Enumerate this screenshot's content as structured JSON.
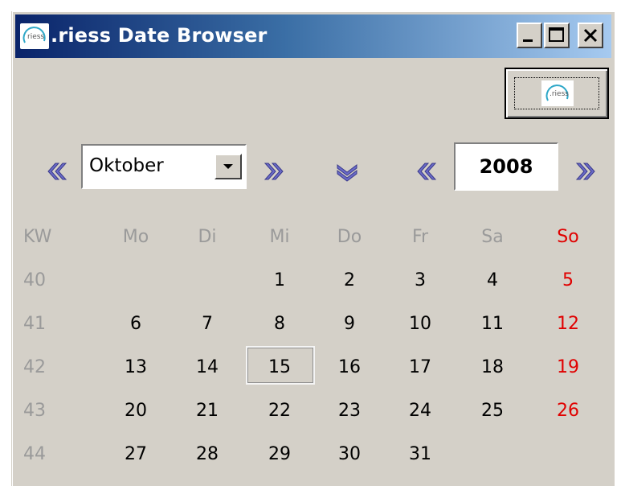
{
  "window": {
    "title": ".riess Date Browser",
    "app_icon": "riess-logo-icon",
    "logo_text": "riess"
  },
  "logo_button": {
    "icon": "riess-logo-icon",
    "text": ".riess"
  },
  "month_nav": {
    "prev_icon": "double-chevron-left-icon",
    "next_icon": "double-chevron-right-icon"
  },
  "month_select": {
    "value": "Oktober"
  },
  "today_toggle": {
    "icon": "double-chevron-down-icon"
  },
  "year_nav": {
    "prev_icon": "double-chevron-left-icon",
    "next_icon": "double-chevron-right-icon",
    "value": "2008"
  },
  "calendar": {
    "headers": [
      "KW",
      "Mo",
      "Di",
      "Mi",
      "Do",
      "Fr",
      "Sa",
      "So"
    ],
    "rows": [
      {
        "week": "40",
        "days": [
          "",
          "",
          "1",
          "2",
          "3",
          "4",
          "5"
        ]
      },
      {
        "week": "41",
        "days": [
          "6",
          "7",
          "8",
          "9",
          "10",
          "11",
          "12"
        ]
      },
      {
        "week": "42",
        "days": [
          "13",
          "14",
          "15",
          "16",
          "17",
          "18",
          "19"
        ]
      },
      {
        "week": "43",
        "days": [
          "20",
          "21",
          "22",
          "23",
          "24",
          "25",
          "26"
        ]
      },
      {
        "week": "44",
        "days": [
          "27",
          "28",
          "29",
          "30",
          "31",
          "",
          ""
        ]
      }
    ],
    "selected_day": "15",
    "weekend_color": "#e00000",
    "muted_color": "#9a9a9a"
  }
}
